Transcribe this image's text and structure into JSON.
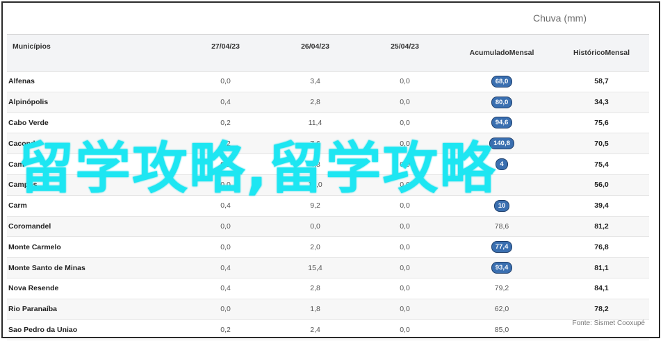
{
  "chuva_label": "Chuva (mm)",
  "headers": {
    "municipios": "Municípios",
    "d1": "27/04/23",
    "d2": "26/04/23",
    "d3": "25/04/23",
    "acum_1": "Acumulado",
    "acum_2": "Mensal",
    "hist_1": "Histórico",
    "hist_2": "Mensal"
  },
  "rows": [
    {
      "name": "Alfenas",
      "d1": "0,0",
      "d2": "3,4",
      "d3": "0,0",
      "acum": "68,0",
      "hist": "58,7",
      "highlight": true
    },
    {
      "name": "Alpinópolis",
      "d1": "0,4",
      "d2": "2,8",
      "d3": "0,0",
      "acum": "80,0",
      "hist": "34,3",
      "highlight": true
    },
    {
      "name": "Cabo Verde",
      "d1": "0,2",
      "d2": "11,4",
      "d3": "0,0",
      "acum": "94,6",
      "hist": "75,6",
      "highlight": true
    },
    {
      "name": "Caconde",
      "d1": "0,2",
      "d2": "7,6",
      "d3": "0,0",
      "acum": "140,8",
      "hist": "70,5",
      "highlight": true
    },
    {
      "name": "Cam",
      "d1": "0,2",
      "d2": "4,8",
      "d3": "0,0",
      "acum": "4",
      "hist": "75,4",
      "highlight": true
    },
    {
      "name": "Campos",
      "d1": "0,0",
      "d2": "13,0",
      "d3": "0,0",
      "acum": "",
      "hist": "56,0",
      "highlight": true
    },
    {
      "name": "Carm",
      "d1": "0,4",
      "d2": "9,2",
      "d3": "0,0",
      "acum": "10",
      "hist": "39,4",
      "highlight": true
    },
    {
      "name": "Coromandel",
      "d1": "0,0",
      "d2": "0,0",
      "d3": "0,0",
      "acum": "78,6",
      "hist": "81,2",
      "highlight": false
    },
    {
      "name": "Monte Carmelo",
      "d1": "0,0",
      "d2": "2,0",
      "d3": "0,0",
      "acum": "77,4",
      "hist": "76,8",
      "highlight": true
    },
    {
      "name": "Monte Santo de Minas",
      "d1": "0,4",
      "d2": "15,4",
      "d3": "0,0",
      "acum": "93,4",
      "hist": "81,1",
      "highlight": true
    },
    {
      "name": "Nova Resende",
      "d1": "0,4",
      "d2": "2,8",
      "d3": "0,0",
      "acum": "79,2",
      "hist": "84,1",
      "highlight": false
    },
    {
      "name": "Rio Paranaíba",
      "d1": "0,0",
      "d2": "1,8",
      "d3": "0,0",
      "acum": "62,0",
      "hist": "78,2",
      "highlight": false
    },
    {
      "name": "Sao Pedro da Uniao",
      "d1": "0,2",
      "d2": "2,4",
      "d3": "0,0",
      "acum": "85,0",
      "hist": "",
      "highlight": false
    }
  ],
  "fonte": "Fonte: Sismet Cooxupé",
  "overlay_text": "留学攻略,留学攻略",
  "colors": {
    "accent_pill": "#3a6fb0",
    "overlay": "#1de6f2"
  }
}
